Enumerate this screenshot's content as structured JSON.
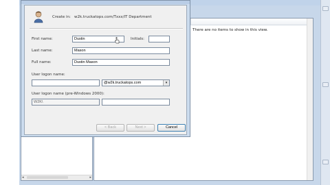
{
  "dialog": {
    "created_in_label": "Create in:",
    "created_in_path": "w2k.truckatops.com/Txxx/IT Department",
    "first_name_label": "First name:",
    "first_name_value": "Dustin",
    "initials_label": "Initials:",
    "initials_value": "",
    "last_name_label": "Last name:",
    "last_name_value": "Mason",
    "full_name_label": "Full name:",
    "full_name_value": "Dustin Mason",
    "logon_label": "User logon name:",
    "logon_value": "",
    "domain_value": "@w2k.truckatops.com",
    "prewin_label": "User logon name (pre-Windows 2000):",
    "prewin_domain": "W2K\\",
    "prewin_value": "",
    "back_label": "< Back",
    "next_label": "Next >",
    "cancel_label": "Cancel"
  },
  "list": {
    "empty_message": "There are no items to show in this view."
  },
  "icons": [
    "user-avatar-icon",
    "dropdown-arrow-icon",
    "mouse-cursor-icon"
  ]
}
